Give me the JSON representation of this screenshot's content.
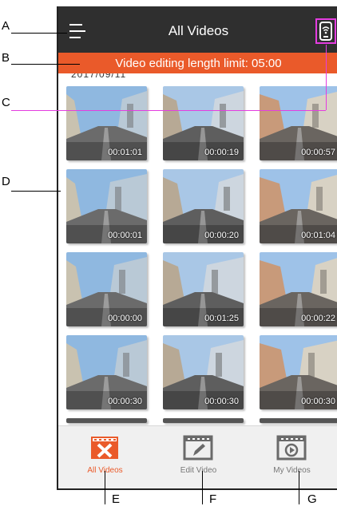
{
  "header": {
    "title": "All Videos",
    "menu_icon": "hamburger-menu-icon",
    "wifi_icon": "wifi-device-icon",
    "accent_color": "#ea5a2a",
    "highlight_color": "#e43ce0"
  },
  "banner": {
    "text": "Video editing length limit: 05:00"
  },
  "date_peek": "2017/09/11",
  "videos": [
    {
      "duration": "00:01:01"
    },
    {
      "duration": "00:00:19"
    },
    {
      "duration": "00:00:57"
    },
    {
      "duration": "00:00:01"
    },
    {
      "duration": "00:00:20"
    },
    {
      "duration": "00:01:04"
    },
    {
      "duration": "00:00:00"
    },
    {
      "duration": "00:01:25"
    },
    {
      "duration": "00:00:22"
    },
    {
      "duration": "00:00:30"
    },
    {
      "duration": "00:00:30"
    },
    {
      "duration": "00:00:30"
    }
  ],
  "tabs": [
    {
      "label": "All Videos",
      "icon": "all-videos-icon",
      "active": true
    },
    {
      "label": "Edit Video",
      "icon": "edit-video-icon",
      "active": false
    },
    {
      "label": "My Videos",
      "icon": "my-videos-icon",
      "active": false
    }
  ],
  "annotations": {
    "a": "A",
    "b": "B",
    "c": "C",
    "d": "D",
    "e": "E",
    "f": "F",
    "g": "G"
  }
}
